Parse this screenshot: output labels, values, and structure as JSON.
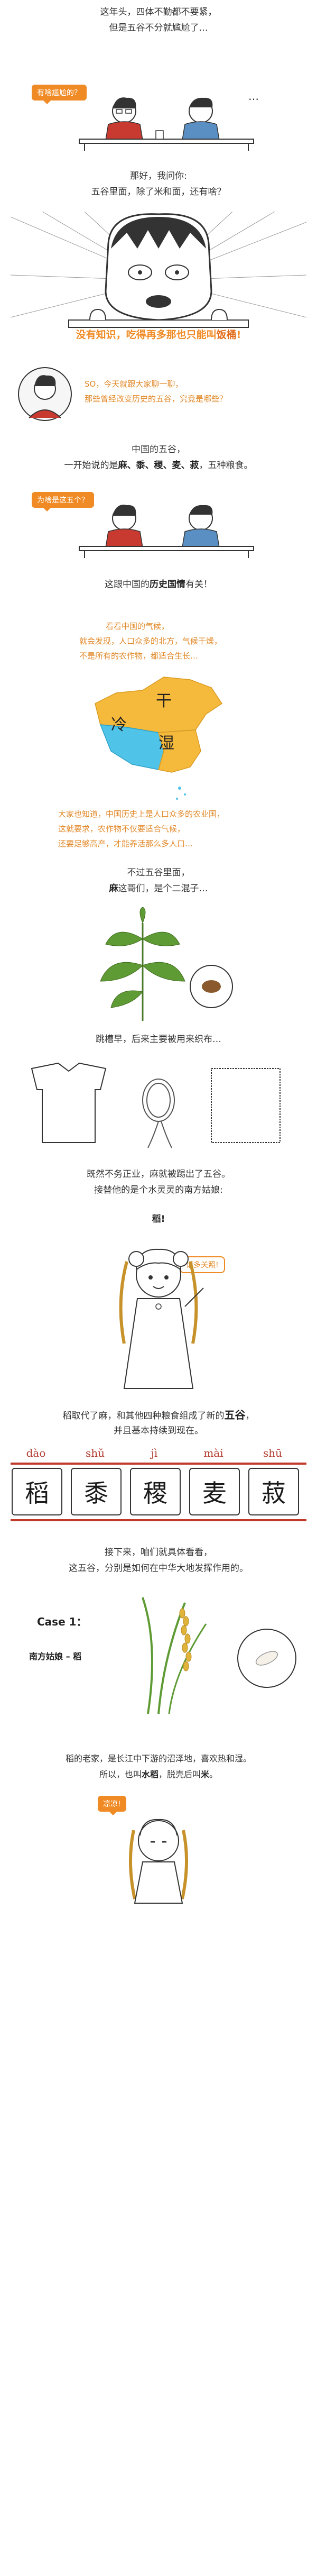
{
  "intro": {
    "line1": "这年头，四体不勤都不要紧，",
    "line2": "但是五谷不分就尴尬了…",
    "bubble_question": "有啥尴尬的？",
    "dots": "…"
  },
  "ask": {
    "line1": "那好，我问你:",
    "line2": "五谷里面，除了米和面，还有啥？"
  },
  "shout": {
    "prefix": "没有知识，吃得再多那也只能叫",
    "highlight": "饭桶",
    "suffix": "!"
  },
  "narrator": {
    "line1": "SO，今天就跟大家聊一聊，",
    "line2": "那些曾经改变历史的五谷，究竟是哪些？"
  },
  "five_grains_intro": {
    "line1": "中国的五谷，",
    "line2_prefix": "一开始说的是",
    "grain_list": "麻、黍、稷、麦、菽",
    "line2_suffix": "，五种粮食。"
  },
  "why_bubble": "为啥是这五个？",
  "history": {
    "prefix": "这跟中国的",
    "highlight": "历史国情",
    "suffix": "有关！"
  },
  "climate": {
    "line1": "看看中国的气候，",
    "line2": "就会发现，人口众多的北方，气候干燥，",
    "line3": "不是所有的农作物，都适合生长…"
  },
  "map": {
    "label_gan": "干",
    "label_leng": "冷",
    "label_shi": "湿"
  },
  "agri": {
    "line1": "大家也知道，中国历史上是人口众多的农业国，",
    "line2": "这就要求，农作物不仅要适合气候，",
    "line3": "还要足够高产，才能养活那么多人口…"
  },
  "hemp": {
    "line1": "不过五谷里面，",
    "line2_bold": "麻",
    "line2_rest": "这哥们，是个二混子…"
  },
  "hemp_use": "跳槽早，后来主要被用来织布…",
  "rice_intro": {
    "line1": "既然不务正业，麻就被踢出了五谷。",
    "line2": "接替他的是个水灵灵的南方姑娘:",
    "line3": "稻!"
  },
  "girl_bubble": "请多关照!",
  "replace": {
    "line1_prefix": "稻取代了麻，和其他四种粮食组成了新的",
    "line1_bold": "五谷",
    "line1_suffix": "，",
    "line2": "并且基本持续到现在。"
  },
  "grains": [
    {
      "pinyin": "dào",
      "char": "稻"
    },
    {
      "pinyin": "shǔ",
      "char": "黍"
    },
    {
      "pinyin": "jì",
      "char": "稷"
    },
    {
      "pinyin": "mài",
      "char": "麦"
    },
    {
      "pinyin": "shū",
      "char": "菽"
    }
  ],
  "next": {
    "line1": "接下来，咱们就具体看看，",
    "line2": "这五谷，分别是如何在中华大地发挥作用的。"
  },
  "case1": {
    "title": "Case 1：",
    "subtitle": "南方姑娘 – 稻"
  },
  "rice_home": {
    "line1": "稻的老家，是长江中下游的沼泽地，喜欢热和湿。",
    "line2_prefix": "所以，也叫",
    "line2_bold1": "水稻",
    "line2_mid": "，脱壳后叫",
    "line2_bold2": "米",
    "line2_suffix": "。"
  },
  "final_bubble": "凉凉!",
  "colors": {
    "accent": "#f08a24",
    "accent_text": "#e28a2b",
    "map_yellow": "#f5b93b",
    "map_blue": "#4fc3e8",
    "stripe_red": "#c0392b"
  }
}
